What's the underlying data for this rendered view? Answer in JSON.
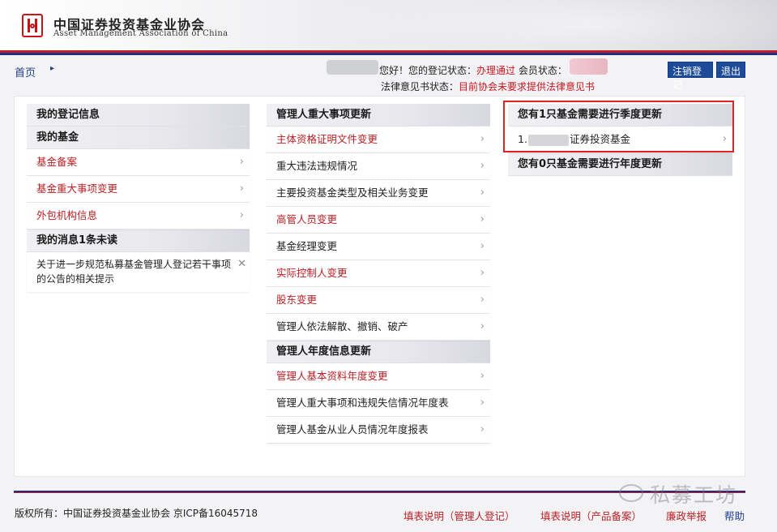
{
  "header": {
    "org_name_cn": "中国证券投资基金业协会",
    "org_name_en": "Asset Management Association of China"
  },
  "breadcrumb": {
    "home": "首页"
  },
  "status": {
    "greeting": "您好！您的登记状态：",
    "reg_status": "办理通过",
    "member_label": " 会员状态：",
    "legal_label": "法律意见书状态：",
    "legal_status": "目前协会未要求提供法律意见书"
  },
  "buttons": {
    "cancel_reg": "注销登记",
    "logout": "退出"
  },
  "col1": {
    "reg_info": "我的登记信息",
    "my_fund": "我的基金",
    "items": [
      "基金备案",
      "基金重大事项变更",
      "外包机构信息"
    ],
    "messages_header": "我的消息1条未读",
    "message_text": "关于进一步规范私募基金管理人登记若干事项的公告的相关提示"
  },
  "col2": {
    "major_header": "管理人重大事项更新",
    "major_items": [
      {
        "label": "主体资格证明文件变更",
        "red": true
      },
      {
        "label": "重大违法违规情况",
        "red": false
      },
      {
        "label": "主要投资基金类型及相关业务变更",
        "red": false
      },
      {
        "label": "高管人员变更",
        "red": true
      },
      {
        "label": "基金经理变更",
        "red": false
      },
      {
        "label": "实际控制人变更",
        "red": true
      },
      {
        "label": "股东变更",
        "red": true
      },
      {
        "label": "管理人依法解散、撤销、破产",
        "red": false
      }
    ],
    "annual_header": "管理人年度信息更新",
    "annual_items": [
      {
        "label": "管理人基本资料年度变更",
        "red": true
      },
      {
        "label": "管理人重大事项和违规失信情况年度表",
        "red": false
      },
      {
        "label": "管理人基金从业人员情况年度报表",
        "red": false
      }
    ]
  },
  "col3": {
    "quarterly_header": "您有1只基金需要进行季度更新",
    "quarterly_item_prefix": "1.",
    "quarterly_item_suffix": "证券投资基金",
    "annual_header": "您有0只基金需要进行年度更新"
  },
  "footer": {
    "copyright": "版权所有：中国证券投资基金业协会 京ICP备16045718",
    "links": [
      "填表说明（管理人登记）",
      "填表说明（产品备案）",
      "廉政举报",
      "帮助"
    ]
  },
  "watermark": "私募工坊",
  "icons": {
    "chevron": "chevron-right-icon",
    "close": "close-icon",
    "logo": "amac-logo-icon"
  }
}
